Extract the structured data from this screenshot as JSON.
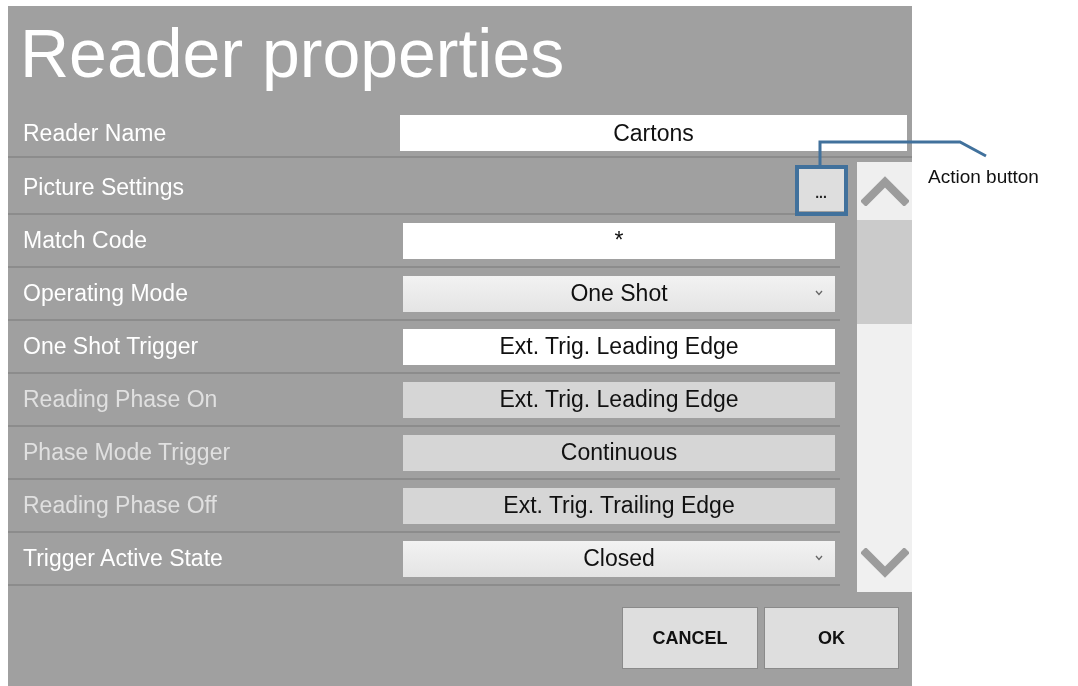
{
  "dialog": {
    "title": "Reader properties"
  },
  "reader_name": {
    "label": "Reader Name",
    "value": "Cartons"
  },
  "properties": [
    {
      "label": "Picture Settings",
      "kind": "action",
      "button": "...",
      "disabled": false
    },
    {
      "label": "Match Code",
      "kind": "text",
      "value": "*",
      "disabled": false
    },
    {
      "label": "Operating Mode",
      "kind": "dropdown",
      "value": "One Shot",
      "disabled": false
    },
    {
      "label": "One Shot Trigger",
      "kind": "text",
      "value": "Ext. Trig. Leading Edge",
      "disabled": false
    },
    {
      "label": "Reading Phase On",
      "kind": "text",
      "value": "Ext. Trig. Leading Edge",
      "disabled": true
    },
    {
      "label": "Phase Mode Trigger",
      "kind": "text",
      "value": "Continuous",
      "disabled": true
    },
    {
      "label": "Reading Phase Off",
      "kind": "text",
      "value": "Ext. Trig. Trailing Edge",
      "disabled": true
    },
    {
      "label": "Trigger Active State",
      "kind": "dropdown",
      "value": "Closed",
      "disabled": false
    }
  ],
  "buttons": [
    {
      "label": "CANCEL"
    },
    {
      "label": "OK"
    }
  ],
  "annotation": {
    "label": "Action button"
  }
}
